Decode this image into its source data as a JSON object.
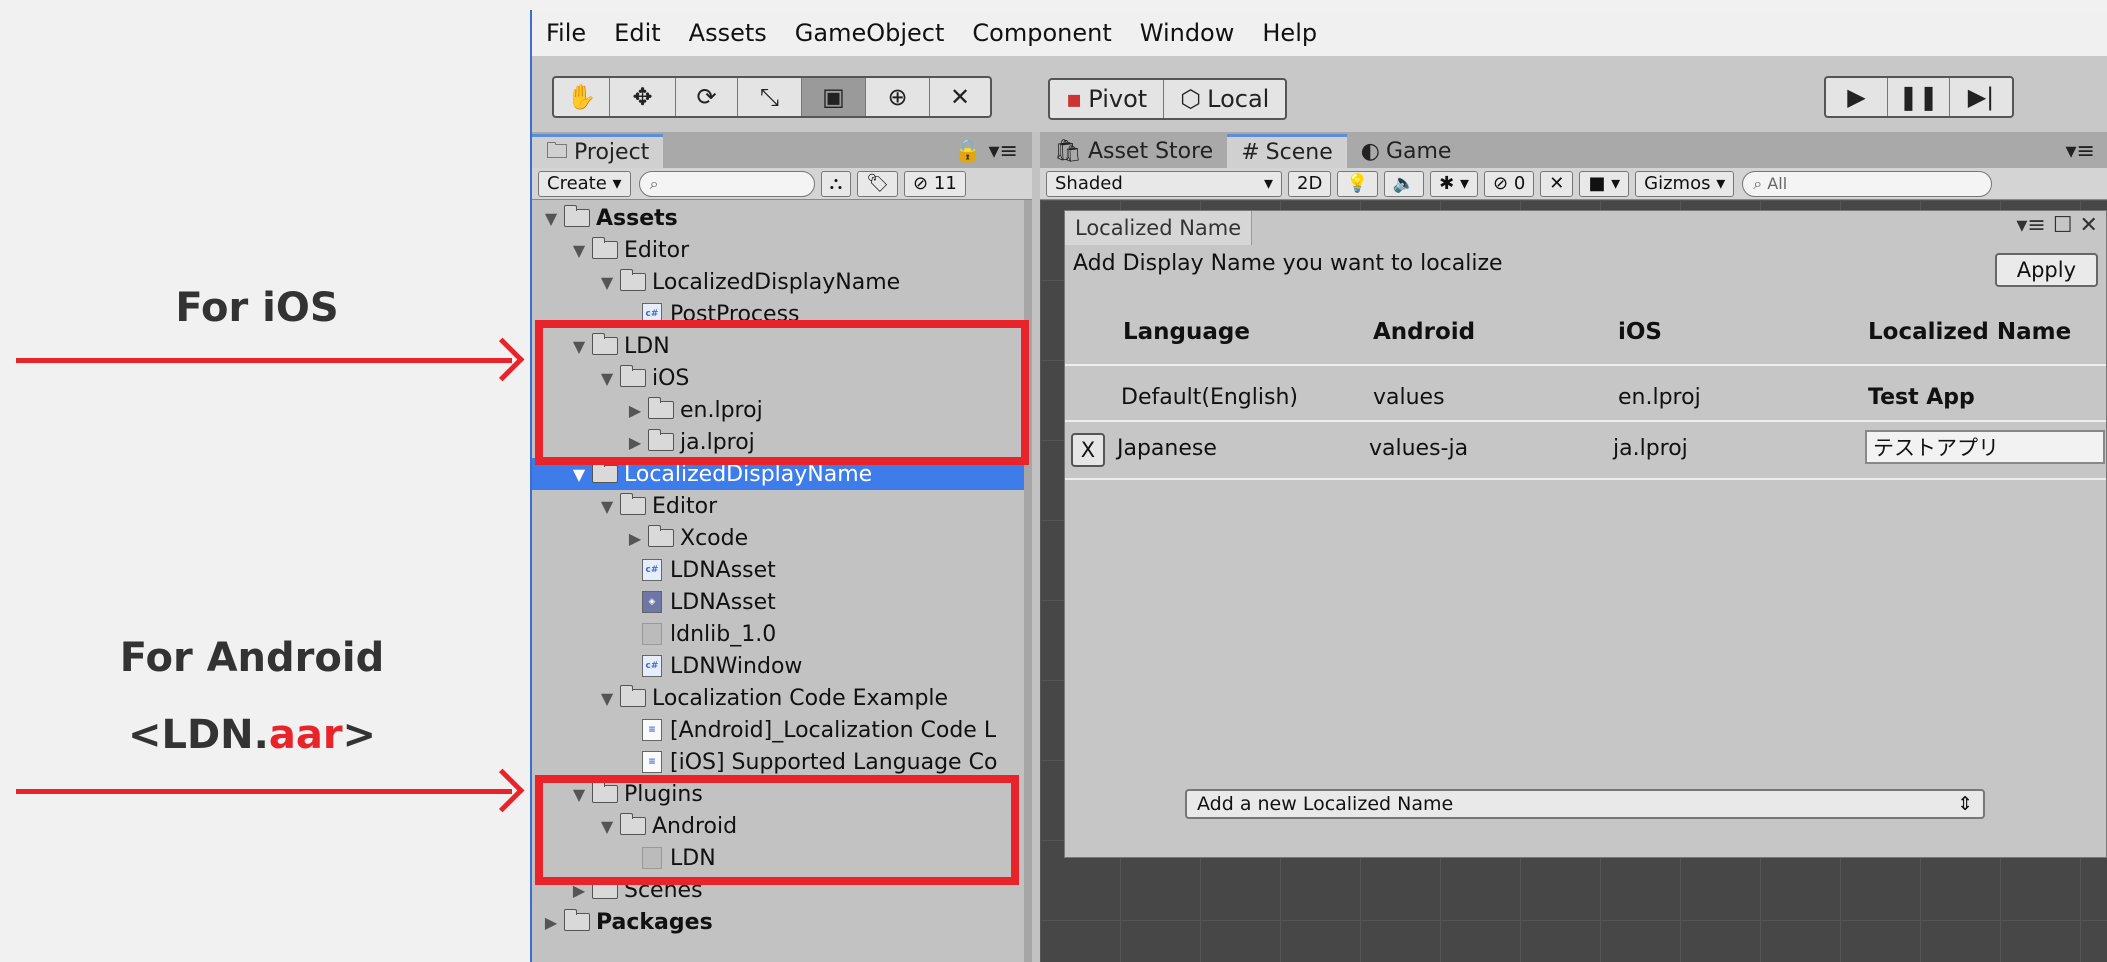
{
  "annotations": {
    "ios_label": "For iOS",
    "android_label": "For Android",
    "android_sub_prefix": "<LDN.",
    "android_sub_highlight": "aar",
    "android_sub_suffix": ">"
  },
  "colors": {
    "highlight": "#e8232a",
    "selection": "#3e7de9"
  },
  "menubar": [
    "File",
    "Edit",
    "Assets",
    "GameObject",
    "Component",
    "Window",
    "Help"
  ],
  "toolbar": {
    "transform_tools": [
      "hand-icon",
      "move-icon",
      "rotate-icon",
      "scale-icon",
      "rect-icon",
      "transform-icon",
      "custom-tool-icon"
    ],
    "pivot_label": "Pivot",
    "local_label": "Local",
    "play_controls": [
      "play-icon",
      "pause-icon",
      "step-icon"
    ]
  },
  "project": {
    "tab_label": "Project",
    "create_label": "Create",
    "hidden_count": "11",
    "tree": [
      {
        "label": "Assets",
        "bold": true
      },
      {
        "label": "Editor"
      },
      {
        "label": "LocalizedDisplayName"
      },
      {
        "label": "PostProcess"
      },
      {
        "label": "LDN"
      },
      {
        "label": "iOS"
      },
      {
        "label": "en.lproj"
      },
      {
        "label": "ja.lproj"
      },
      {
        "label": "LocalizedDisplayName",
        "selected": true
      },
      {
        "label": "Editor"
      },
      {
        "label": "Xcode"
      },
      {
        "label": "LDNAsset"
      },
      {
        "label": "LDNAsset"
      },
      {
        "label": "ldnlib_1.0"
      },
      {
        "label": "LDNWindow"
      },
      {
        "label": "Localization Code Example"
      },
      {
        "label": "[Android]_Localization Code L"
      },
      {
        "label": "[iOS] Supported Language Co"
      },
      {
        "label": "Plugins"
      },
      {
        "label": "Android"
      },
      {
        "label": "LDN"
      },
      {
        "label": "Scenes"
      },
      {
        "label": "Packages",
        "bold": true
      }
    ]
  },
  "scene_tabs": {
    "asset_store": "Asset Store",
    "scene": "Scene",
    "game": "Game"
  },
  "scene_controls": {
    "shading": "Shaded",
    "mode_2d": "2D",
    "hidden_count": "0",
    "gizmos": "Gizmos",
    "search_placeholder": "All"
  },
  "localized_window": {
    "title": "Localized Name",
    "instruction": "Add Display Name you want to localize",
    "apply_label": "Apply",
    "headers": [
      "Language",
      "Android",
      "iOS",
      "Localized Name"
    ],
    "rows": [
      {
        "language": "Default(English)",
        "android": "values",
        "ios": "en.lproj",
        "name": "Test App"
      },
      {
        "language": "Japanese",
        "android": "values-ja",
        "ios": "ja.lproj",
        "name": "テストアプリ"
      }
    ],
    "remove_label": "X",
    "add_dropdown": "Add a new Localized Name"
  }
}
